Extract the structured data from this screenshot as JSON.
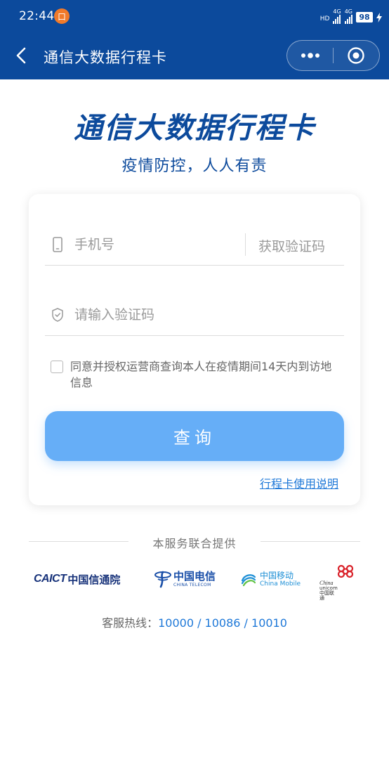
{
  "status_bar": {
    "time": "22:44",
    "app_badge": "口",
    "network_hd": "HD",
    "network_1": "4G",
    "network_2": "4G",
    "battery": "98"
  },
  "nav": {
    "title": "通信大数据行程卡"
  },
  "hero": {
    "title": "通信大数据行程卡",
    "subtitle": "疫情防控，人人有责"
  },
  "form": {
    "phone_placeholder": "手机号",
    "get_code_label": "获取验证码",
    "code_placeholder": "请输入验证码",
    "agreement_text": "同意并授权运营商查询本人在疫情期间14天内到访地信息",
    "agreement_checked": false,
    "submit_label": "查询",
    "guide_link": "行程卡使用说明"
  },
  "providers": {
    "title": "本服务联合提供",
    "caict_en": "CAICT",
    "caict_cn": "中国信通院",
    "telecom_cn": "中国电信",
    "telecom_en": "CHINA TELECOM",
    "mobile_cn": "中国移动",
    "mobile_en": "China Mobile",
    "unicom_en_1": "China",
    "unicom_en_2": "unicom中国联通"
  },
  "hotline": {
    "label": "客服热线：",
    "numbers": "10000 / 10086 / 10010"
  },
  "colors": {
    "brand": "#0c4a9c",
    "button": "#66aef7",
    "link": "#1e78d8"
  }
}
